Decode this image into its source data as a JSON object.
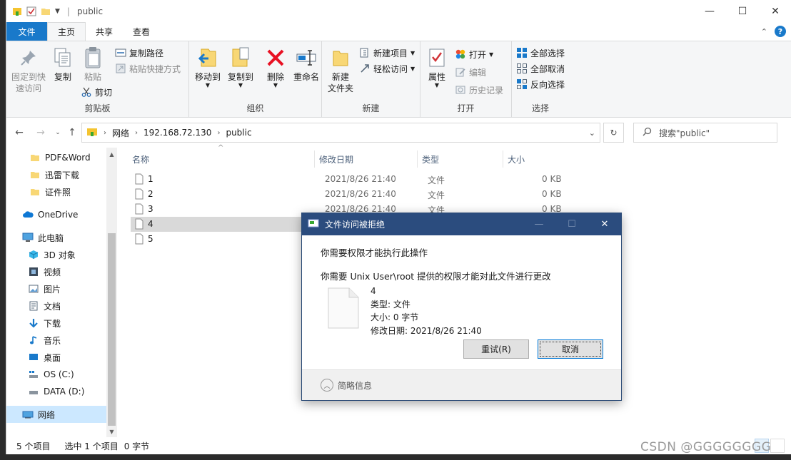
{
  "window": {
    "title": "public",
    "controls": {
      "minimize": "—",
      "maximize": "☐",
      "close": "✕"
    }
  },
  "tabs": {
    "file": "文件",
    "home": "主页",
    "share": "共享",
    "view": "查看"
  },
  "ribbon": {
    "clipboard": {
      "label": "剪贴板",
      "pin": "固定到快速访问",
      "pin_line1": "固定到快",
      "pin_line2": "速访问",
      "copy": "复制",
      "paste": "粘贴",
      "copy_path": "复制路径",
      "paste_shortcut": "粘贴快捷方式",
      "cut": "剪切"
    },
    "organize": {
      "label": "组织",
      "move_to": "移动到",
      "copy_to": "复制到",
      "delete": "删除",
      "rename": "重命名"
    },
    "new": {
      "label": "新建",
      "new_folder_line1": "新建",
      "new_folder_line2": "文件夹",
      "new_item": "新建项目",
      "easy_access": "轻松访问"
    },
    "open": {
      "label": "打开",
      "properties": "属性",
      "open": "打开",
      "edit": "编辑",
      "history": "历史记录"
    },
    "select": {
      "label": "选择",
      "select_all": "全部选择",
      "select_none": "全部取消",
      "invert": "反向选择"
    }
  },
  "address": {
    "crumbs": [
      "网络",
      "192.168.72.130",
      "public"
    ],
    "search_placeholder": "搜索\"public\""
  },
  "navpane": {
    "items": [
      {
        "label": "PDF&Word"
      },
      {
        "label": "迅雷下载"
      },
      {
        "label": "证件照"
      },
      {
        "label": "OneDrive"
      },
      {
        "label": "此电脑"
      },
      {
        "label": "3D 对象"
      },
      {
        "label": "视频"
      },
      {
        "label": "图片"
      },
      {
        "label": "文档"
      },
      {
        "label": "下载"
      },
      {
        "label": "音乐"
      },
      {
        "label": "桌面"
      },
      {
        "label": "OS (C:)"
      },
      {
        "label": "DATA (D:)"
      },
      {
        "label": "网络"
      }
    ]
  },
  "filelist": {
    "columns": [
      "名称",
      "修改日期",
      "类型",
      "大小"
    ],
    "rows": [
      {
        "name": "1",
        "date": "2021/8/26 21:40",
        "type": "文件",
        "size": "0 KB"
      },
      {
        "name": "2",
        "date": "2021/8/26 21:40",
        "type": "文件",
        "size": "0 KB"
      },
      {
        "name": "3",
        "date": "2021/8/26 21:40",
        "type": "文件",
        "size": "0 KB"
      },
      {
        "name": "4",
        "date": "",
        "type": "",
        "size": ""
      },
      {
        "name": "5",
        "date": "",
        "type": "",
        "size": ""
      }
    ]
  },
  "status": {
    "count": "5 个项目",
    "selection": "选中 1 个项目",
    "size": "0 字节"
  },
  "dialog": {
    "title": "文件访问被拒绝",
    "message1": "你需要权限才能执行此操作",
    "message2": "你需要 Unix User\\root 提供的权限才能对此文件进行更改",
    "file_name": "4",
    "file_type": "类型: 文件",
    "file_size": "大小: 0 字节",
    "file_modified": "修改日期: 2021/8/26 21:40",
    "retry": "重试(R)",
    "cancel": "取消",
    "details": "简略信息"
  },
  "watermark": "CSDN @GGGGGGGG"
}
